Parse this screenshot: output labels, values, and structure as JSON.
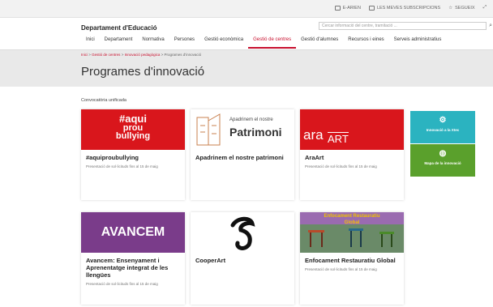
{
  "topbar": {
    "lang": "E-ARIEN",
    "subs": "LES MEVES SUBSCRIPCIONS",
    "follow": "SEGUEIX"
  },
  "header": {
    "org": "Departament d'Educació",
    "search_placeholder": "Cercar informació del centre, tramitació ..."
  },
  "nav": [
    {
      "label": "Inici"
    },
    {
      "label": "Departament"
    },
    {
      "label": "Normativa"
    },
    {
      "label": "Persones"
    },
    {
      "label": "Gestió econòmica"
    },
    {
      "label": "Gestió de centres"
    },
    {
      "label": "Gestió d'alumnes"
    },
    {
      "label": "Recursos i eines"
    },
    {
      "label": "Serveis administratius"
    }
  ],
  "breadcrumb": {
    "a": "Inici",
    "b": "Gestió de centres",
    "c": "Innovació pedagògica",
    "d": "Programes d'innovació"
  },
  "page": {
    "title": "Programes d'innovació",
    "section": "Convocatòria unificada"
  },
  "cards": [
    {
      "title": "#aquiproubullying",
      "sub": "Presentació de sol·licituds fins al 15 de maig",
      "img_text1": "#aqui",
      "img_text2": "prou",
      "img_text3": "bullying"
    },
    {
      "title": "Apadrinem el nostre patrimoni",
      "sub": "",
      "img_text1": "Apadrinem el nostre",
      "img_text2": "Patrimoni"
    },
    {
      "title": "AraArt",
      "sub": "Presentació de sol·licituds fins al 15 de maig",
      "img_text1": "ara",
      "img_text2": "ART"
    },
    {
      "title": "Avancem: Ensenyament i Aprenentatge integrat de les llengües",
      "sub": "Presentació de sol·licituds fins al 15 de maig",
      "img_text1": "AVANCEM"
    },
    {
      "title": "CooperArt",
      "sub": ""
    },
    {
      "title": "Enfocament Restauratiu Global",
      "sub": "Presentació de sol·licituds fins al 15 de maig",
      "img_text1": "Enfocament Restauratiu",
      "img_text2": "Global"
    }
  ],
  "side": [
    {
      "label": "Innovació a la Xtec",
      "color": "#2bb3c0"
    },
    {
      "label": "Mapa de la innovació",
      "color": "#5aa02c"
    }
  ],
  "colors": {
    "accent": "#c8102e"
  }
}
